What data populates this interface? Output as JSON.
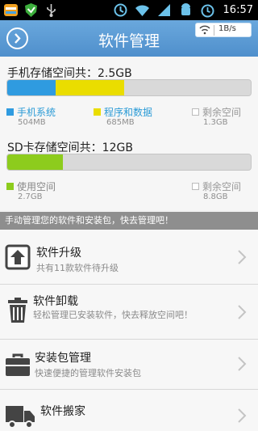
{
  "statusbar": {
    "time": "16:57",
    "left_icons": [
      "app-launcher-icon",
      "shield-icon",
      "usb-icon"
    ],
    "right_icons": [
      "sync-icon",
      "wifi-icon",
      "signal-icon",
      "android-icon",
      "alarm-icon"
    ]
  },
  "header": {
    "title": "软件管理",
    "speed": "1B/s",
    "back_icon": "chevron-right-circle-icon"
  },
  "phone_storage": {
    "title": "手机存储空间共：2.5GB",
    "usage": [
      {
        "label": "手机系统",
        "size": "504MB",
        "color": "#2f9be0",
        "fraction": 0.2
      },
      {
        "label": "程序和数据",
        "size": "685MB",
        "color": "#eadd00",
        "fraction": 0.28
      },
      {
        "label": "剩余空间",
        "size": "1.3GB",
        "color": "#d9d9d9",
        "fraction": 0.52
      }
    ]
  },
  "sd_storage": {
    "title": "SD卡存储空间共：12GB",
    "usage": [
      {
        "label": "使用空间",
        "size": "2.7GB",
        "color": "#8dcc1d",
        "fraction": 0.23
      },
      {
        "label": "剩余空间",
        "size": "8.8GB",
        "color": "#d9d9d9",
        "fraction": 0.77
      }
    ]
  },
  "tip": "手动管理您的软件和安装包，快去管理吧！",
  "menu": [
    {
      "title": "软件升级",
      "subtitle": "共有11款软件待升级",
      "icon": "upgrade-icon"
    },
    {
      "title": "软件卸载",
      "subtitle": "轻松管理已安装软件，快去释放空间吧！",
      "icon": "trash-icon"
    },
    {
      "title": "安装包管理",
      "subtitle": "快速便捷的管理软件安装包",
      "icon": "toolbox-icon"
    },
    {
      "title": "软件搬家",
      "subtitle": "",
      "icon": "truck-icon"
    }
  ]
}
